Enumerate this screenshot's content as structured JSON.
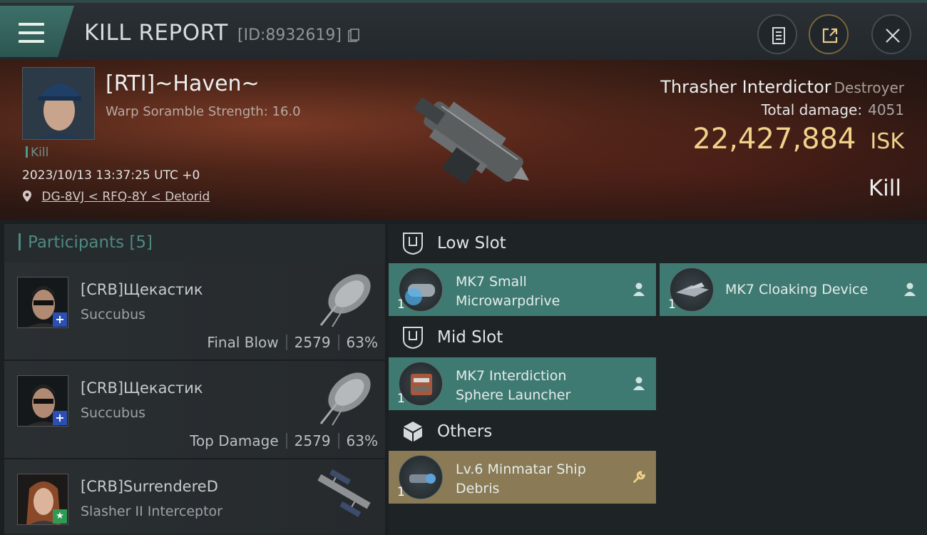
{
  "header": {
    "title": "KILL REPORT",
    "id_text": "[ID:8932619]"
  },
  "victim": {
    "name": "[RTI]~Haven~",
    "warp_scramble": "Warp Soramble Strength: 16.0",
    "kill_tag": "Kill",
    "timestamp": "2023/10/13 13:37:25 UTC +0",
    "location": "DG-8VJ < RFQ-8Y < Detorid",
    "ship_name": "Thrasher Interdictor",
    "ship_class": "Destroyer",
    "total_damage_label": "Total damage:",
    "total_damage": "4051",
    "isk_value": "22,427,884",
    "isk_unit": "ISK",
    "result": "Kill"
  },
  "participants": {
    "label": "Participants",
    "count": "[5]",
    "rows": [
      {
        "name": "[CRB]Щекастик",
        "ship": "Succubus",
        "tag": "Final Blow",
        "damage": "2579",
        "percent": "63%",
        "badge": "+"
      },
      {
        "name": "[CRB]Щекастик",
        "ship": "Succubus",
        "tag": "Top Damage",
        "damage": "2579",
        "percent": "63%",
        "badge": "+"
      },
      {
        "name": "[CRB]SurrendereD",
        "ship": "Slasher II Interceptor",
        "tag": "",
        "damage": "",
        "percent": "",
        "badge": "★"
      }
    ]
  },
  "slots": {
    "low": {
      "label": "Low Slot",
      "items": [
        {
          "name_line1": "MK7 Small",
          "name_line2": "Microwarpdrive",
          "qty": "1"
        },
        {
          "name_line1": "MK7 Cloaking Device",
          "name_line2": "",
          "qty": "1"
        }
      ]
    },
    "mid": {
      "label": "Mid Slot",
      "items": [
        {
          "name_line1": "MK7 Interdiction",
          "name_line2": "Sphere Launcher",
          "qty": "1"
        }
      ]
    },
    "others": {
      "label": "Others",
      "items": [
        {
          "name_line1": "Lv.6 Minmatar Ship",
          "name_line2": "Debris",
          "qty": "1"
        }
      ]
    }
  },
  "colors": {
    "teal_item": "#3f7a72",
    "gold_item": "#8a7a55",
    "isk_gold": "#f0d28a"
  }
}
